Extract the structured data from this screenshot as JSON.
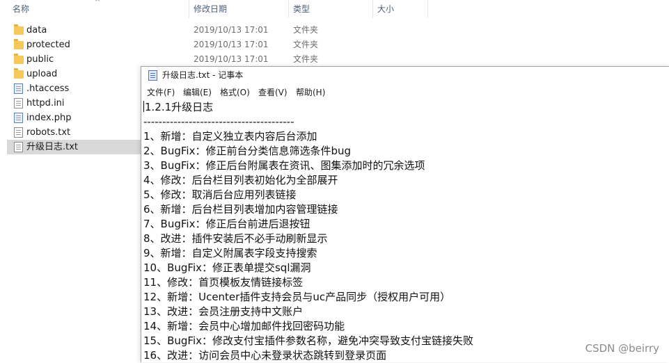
{
  "explorer": {
    "columns": {
      "name": "名称",
      "date": "修改日期",
      "type": "类型",
      "size": "大小"
    },
    "files": [
      {
        "name": "data",
        "icon": "folder-icon",
        "date": "2019/10/13 17:01",
        "type": "文件夹"
      },
      {
        "name": "protected",
        "icon": "folder-icon",
        "date": "2019/10/13 17:01",
        "type": "文件夹"
      },
      {
        "name": "public",
        "icon": "folder-icon",
        "date": "2019/10/13 17:01",
        "type": "文件夹"
      },
      {
        "name": "upload",
        "icon": "folder-icon",
        "date": "",
        "type": ""
      },
      {
        "name": ".htaccess",
        "icon": "file-icon",
        "date": "",
        "type": ""
      },
      {
        "name": "httpd.ini",
        "icon": "file-icon",
        "date": "",
        "type": ""
      },
      {
        "name": "index.php",
        "icon": "php-file-icon",
        "date": "",
        "type": ""
      },
      {
        "name": "robots.txt",
        "icon": "text-file-icon",
        "date": "",
        "type": ""
      },
      {
        "name": "升级日志.txt",
        "icon": "text-file-icon",
        "date": "",
        "type": ""
      }
    ]
  },
  "notepad": {
    "title": "升级日志.txt - 记事本",
    "menu": [
      "文件(F)",
      "编辑(E)",
      "格式(O)",
      "查看(V)",
      "帮助(H)"
    ],
    "lines": [
      "1.2.1升级日志",
      "----------------------------------------",
      "1、新增：自定义独立表内容后台添加",
      "2、BugFix：修正前台分类信息筛选条件bug",
      "3、BugFix：修正后台附属表在资讯、图集添加时的冗余选项",
      "4、修改：后台栏目列表初始化为全部展开",
      "5、修改：取消后台应用列表链接",
      "6、新增：后台栏目列表增加内容管理链接",
      "7、BugFix：修正后台前进后退按钮",
      "8、改进：插件安装后不必手动刷新显示",
      "9、新增：自定义附属表字段支持搜索",
      "10、BugFix：修正表单提交sql漏洞",
      "11、修改：首页模板友情链接标签",
      "12、新增：Ucenter插件支持会员与uc产品同步（授权用户可用）",
      "13、改进：会员注册支持中文账户",
      "14、新增：会员中心增加邮件找回密码功能",
      "15、BugFix：修改支付宝插件参数名称，避免冲突导致支付宝链接失败",
      "16、改进：访问会员中心未登录状态跳转到登录页面"
    ]
  },
  "watermark": "CSDN @beirry"
}
